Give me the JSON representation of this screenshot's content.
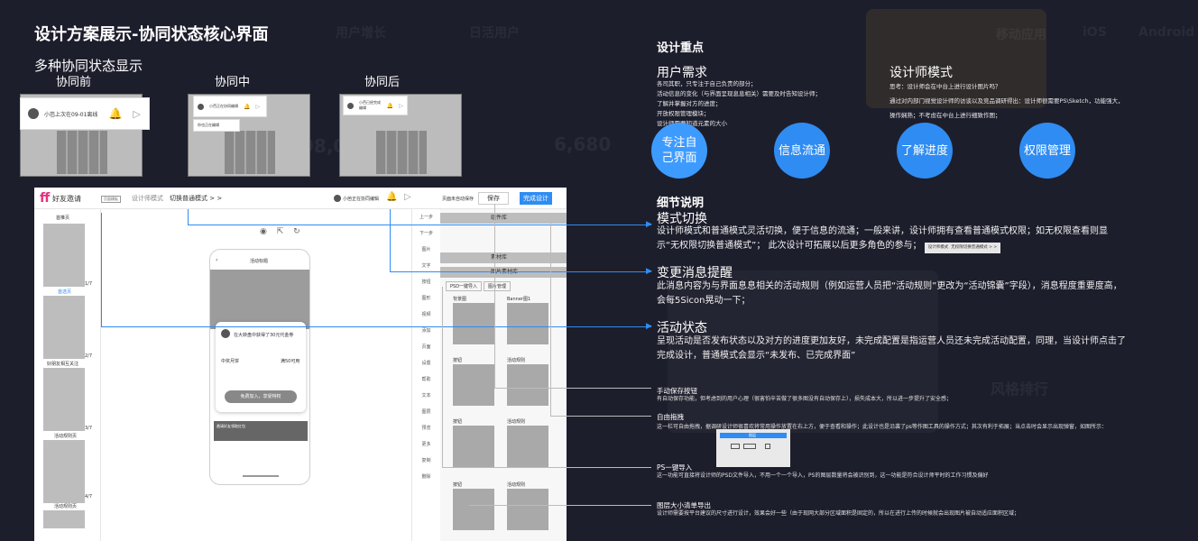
{
  "page": {
    "title": "设计方案展示-协同状态核心界面",
    "subtitle": "多种协同状态显示"
  },
  "states": [
    {
      "label": "协同前",
      "card_text": "小芭上次在09-01离线"
    },
    {
      "label": "协同中",
      "card_text": "小芭正在协同编辑",
      "card_text2": "你也正在编辑"
    },
    {
      "label": "协同后",
      "card_text": "小芭已经完成编辑"
    }
  ],
  "mock": {
    "logo_text": "好友邀请",
    "select_text": "页面模板",
    "mode_designer": "设计师模式",
    "mode_switch": "切换普通模式 > >",
    "collab_status": "小芭正在协同编辑",
    "draft_status": "页面未自动保存",
    "save_label": "保存",
    "done_label": "完成设计",
    "left_pages": [
      "首推页",
      "首选页",
      "好朋友相互关注",
      "活动规则页",
      "活动规则页"
    ],
    "left_page_numbers": [
      "1/7",
      "2/7",
      "3/7",
      "4/7"
    ],
    "phone_title": "活动标题",
    "phone_card_text": "在大转盘中获得了30元代金券",
    "phone_card_label": "中奖月饼",
    "phone_card_value": "满50可用",
    "phone_button": "免费加入，享受特权",
    "phone_banner": "邀请好友领取红包",
    "tools": [
      "上一步",
      "下一步",
      "图片",
      "文字",
      "按钮",
      "图形",
      "视频",
      "添加",
      "页面",
      "设置",
      "帮助",
      "文本",
      "图层",
      "预览",
      "更多",
      "复制",
      "删除"
    ],
    "right_headers": [
      "组件库",
      "素材库",
      "图片素材库"
    ],
    "right_tabs": [
      "PSD一键导入",
      "图片管理"
    ],
    "right_labels": [
      "背景图",
      "Banner图1",
      "按钮",
      "活动规则",
      "按钮",
      "活动规则",
      "按钮",
      "活动规则"
    ]
  },
  "focus": {
    "title": "设计重点",
    "user_need_title": "用户需求",
    "user_need_lines": [
      "各司其职，只专注于自己负责的部分；",
      "活动信息的变化（与界面呈现息息相关）需要及时告知设计师；",
      "了解并掌握对方的进度；",
      "开放权限管理模块；",
      "设计师需要知道元素的大小"
    ],
    "designer_title": "设计师模式",
    "designer_lines": [
      "思考：设计师会在中台上进行设计图片吗？",
      "通过对内部门视觉设计师的访谈以及竞品调研得出：设计师很需要PS\\Sketch，功能强大，",
      "操作娴熟；不考虑在中台上进行细致作图；"
    ],
    "circles": [
      "专注自己界面",
      "信息流通",
      "了解进度",
      "权限管理"
    ]
  },
  "details": {
    "title": "细节说明",
    "items": [
      {
        "title": "模式切换",
        "body": "设计师模式和普通模式灵活切换，便于信息的流通；一般来讲，设计师拥有查看普通模式权限；如无权限查看则显示“无权限切换普通模式”；  此次设计可拓展以后更多角色的参与；",
        "chip_a": "设计师模式",
        "chip_b": "无权限切换普通模式 > >"
      },
      {
        "title": "变更消息提醒",
        "body": "此消息内容为与界面息息相关的活动规则（例如运营人员把“活动规则”更改为“活动锦囊”字段），消息程度重要度高，会每5Sicon晃动一下；"
      },
      {
        "title": "活动状态",
        "body": "呈现活动是否发布状态以及对方的进度更加友好，未完成配置是指运营人员还未完成活动配置，同理，当设计师点击了完成设计，普通模式会显示“未发布、已完成界面”"
      }
    ],
    "features": [
      {
        "title": "手动保存按钮",
        "body": "有自动保存功能，但考虑到的用户心理（很害怕辛苦做了很多图没有自动保存上），损失成本大，所以进一步提升了安全感；"
      },
      {
        "title": "自由拖拽",
        "body": "这一栏可自由拖拽，据调研设计师很喜欢将常用操作放置在右上方，便于查看和操作；此设计也是沿袭了ps等作图工具的操作方式；其次有利于拓展；当点击时会显示出现弹窗，如图所示：",
        "mini_panel": "图层"
      },
      {
        "title": "PS一键导入",
        "body": "这一功能可直接将设计师的PSD文件导入，不用一个一个导入，PS的图层数量将会被识别到，这一功能是符合设计师平时的工作习惯及偏好"
      },
      {
        "title": "图层大小清单导出",
        "body": "设计师需要按平台建议的尺寸进行设计，效果会好一些（由于现网大部分区域面积是固定的，所以在进行上传的时候就会出现图片被自动适应面积区域；"
      }
    ]
  },
  "background": {
    "words": [
      "移动应用",
      "iOS",
      "Android",
      "用户增长",
      "日活用户",
      "98,0",
      "6,680",
      "风格排行"
    ]
  },
  "colors": {
    "accent": "#2f8cf2",
    "background": "#1d1e2c",
    "logo": "#e6317f"
  }
}
